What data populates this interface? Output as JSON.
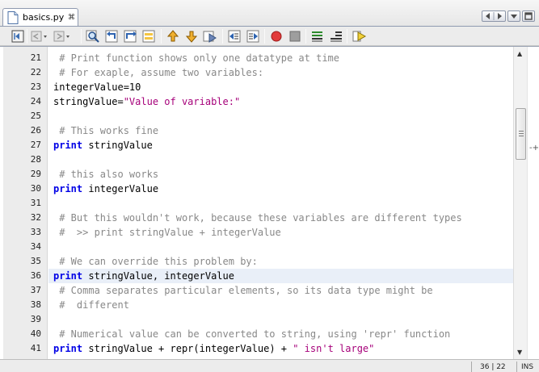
{
  "tab": {
    "filename": "basics.py",
    "close_glyph": "⌘"
  },
  "toolbar": {
    "icons": [
      "back-history-icon",
      "nav-back-icon",
      "nav-forward-icon",
      "find-icon",
      "find-previous-icon",
      "find-next-icon",
      "toggle-highlight-icon",
      "previous-bookmark-icon",
      "next-bookmark-icon",
      "toggle-bookmark-icon",
      "shift-left-icon",
      "shift-right-icon",
      "start-macro-icon",
      "stop-macro-icon",
      "comment-icon",
      "uncomment-icon",
      "run-icon"
    ]
  },
  "editor": {
    "current_line": 36,
    "lines": [
      {
        "num": "21",
        "tokens": [
          {
            "t": " # Print function shows only one datatype at time",
            "c": "comment"
          }
        ]
      },
      {
        "num": "22",
        "tokens": [
          {
            "t": " # For exaple, assume two variables:",
            "c": "comment"
          }
        ]
      },
      {
        "num": "23",
        "tokens": [
          {
            "t": "integerValue=10",
            "c": "plain"
          }
        ]
      },
      {
        "num": "24",
        "tokens": [
          {
            "t": "stringValue=",
            "c": "plain"
          },
          {
            "t": "\"Value of variable:\"",
            "c": "string"
          }
        ]
      },
      {
        "num": "25",
        "tokens": []
      },
      {
        "num": "26",
        "tokens": [
          {
            "t": " # This works fine",
            "c": "comment"
          }
        ]
      },
      {
        "num": "27",
        "tokens": [
          {
            "t": "print",
            "c": "keyword"
          },
          {
            "t": " stringValue",
            "c": "plain"
          }
        ]
      },
      {
        "num": "28",
        "tokens": []
      },
      {
        "num": "29",
        "tokens": [
          {
            "t": " # this also works",
            "c": "comment"
          }
        ]
      },
      {
        "num": "30",
        "tokens": [
          {
            "t": "print",
            "c": "keyword"
          },
          {
            "t": " integerValue",
            "c": "plain"
          }
        ]
      },
      {
        "num": "31",
        "tokens": []
      },
      {
        "num": "32",
        "tokens": [
          {
            "t": " # But this wouldn't work, because these variables are different types",
            "c": "comment"
          }
        ]
      },
      {
        "num": "33",
        "tokens": [
          {
            "t": " #  >> print stringValue + integerValue",
            "c": "comment"
          }
        ]
      },
      {
        "num": "34",
        "tokens": []
      },
      {
        "num": "35",
        "tokens": [
          {
            "t": " # We can override this problem by:",
            "c": "comment"
          }
        ]
      },
      {
        "num": "36",
        "tokens": [
          {
            "t": "print",
            "c": "keyword"
          },
          {
            "t": " stringValue, integerValue",
            "c": "plain"
          }
        ]
      },
      {
        "num": "37",
        "tokens": [
          {
            "t": " # Comma separates particular elements, so its data type might be",
            "c": "comment"
          }
        ]
      },
      {
        "num": "38",
        "tokens": [
          {
            "t": " #  different",
            "c": "comment"
          }
        ]
      },
      {
        "num": "39",
        "tokens": []
      },
      {
        "num": "40",
        "tokens": [
          {
            "t": " # Numerical value can be converted to string, using 'repr' function",
            "c": "comment"
          }
        ]
      },
      {
        "num": "41",
        "tokens": [
          {
            "t": "print",
            "c": "keyword"
          },
          {
            "t": " stringValue + repr(integerValue) + ",
            "c": "plain"
          },
          {
            "t": "\" isn't large\"",
            "c": "string"
          }
        ]
      }
    ]
  },
  "statusbar": {
    "position": "36 | 22",
    "mode": "INS"
  },
  "colors": {
    "comment": "#888888",
    "keyword": "#0000e6",
    "string": "#a6007a",
    "current_line": "#e9eff8"
  }
}
